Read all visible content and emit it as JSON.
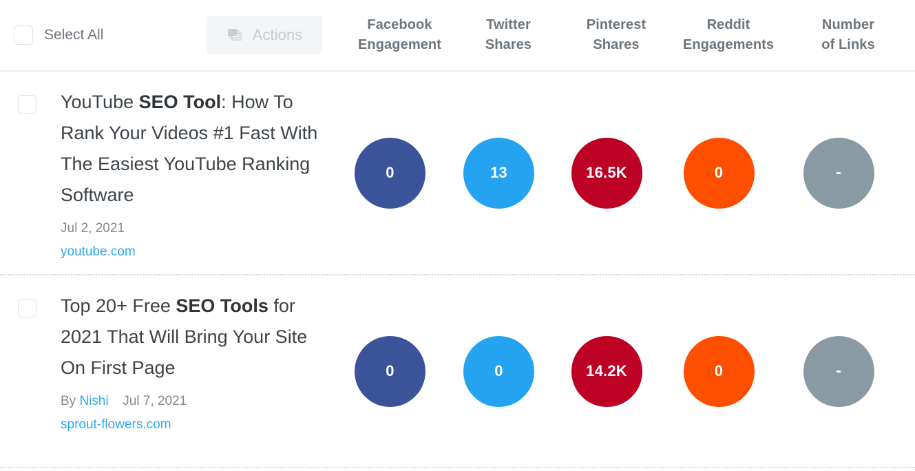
{
  "toolbar": {
    "select_all_label": "Select All",
    "actions_label": "Actions",
    "actions_icon": "layers-icon",
    "checkbox_checked": false
  },
  "columns": [
    {
      "key": "facebook",
      "line1": "Facebook",
      "line2": "Engagement",
      "color": "#3b5499"
    },
    {
      "key": "twitter",
      "line1": "Twitter",
      "line2": "Shares",
      "color": "#24a3f0"
    },
    {
      "key": "pinterest",
      "line1": "Pinterest",
      "line2": "Shares",
      "color": "#bd0124"
    },
    {
      "key": "reddit",
      "line1": "Reddit",
      "line2": "Engagements",
      "color": "#fe4f00"
    },
    {
      "key": "links",
      "line1": "Number",
      "line2": "of Links",
      "color": "#8a9aa3"
    }
  ],
  "rows": [
    {
      "title_pre": "YouTube ",
      "title_bold": "SEO Tool",
      "title_post": ": How To Rank Your Videos #1 Fast With The Easiest YouTube Ranking Software",
      "by_label": "",
      "author": "",
      "date": "Jul 2, 2021",
      "domain": "youtube.com",
      "metrics": {
        "facebook": "0",
        "twitter": "13",
        "pinterest": "16.5K",
        "reddit": "0",
        "links": "-"
      }
    },
    {
      "title_pre": "Top 20+ Free ",
      "title_bold": "SEO Tools",
      "title_post": " for 2021 That Will Bring Your Site On First Page",
      "by_label": "By",
      "author": "Nishi",
      "date": "Jul 7, 2021",
      "domain": "sprout-flowers.com",
      "metrics": {
        "facebook": "0",
        "twitter": "0",
        "pinterest": "14.2K",
        "reddit": "0",
        "links": "-"
      }
    }
  ],
  "colors": {
    "facebook": "#3b5499",
    "twitter": "#24a3f0",
    "pinterest": "#bd0124",
    "reddit": "#fe4f00",
    "links": "#8a9aa3",
    "link_text": "#2ea8ee",
    "header_text": "#6d757c",
    "title_text": "#3d4449"
  }
}
